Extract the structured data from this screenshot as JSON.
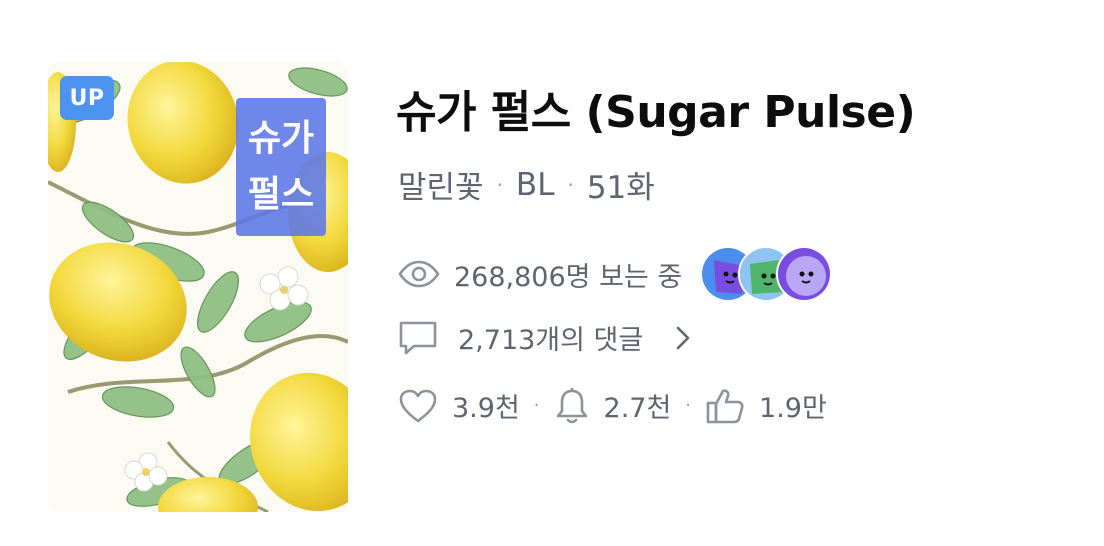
{
  "cover": {
    "badge": "UP",
    "title_line1": "슈가",
    "title_line2": "펄스"
  },
  "title": "슈가 펄스 (Sugar Pulse)",
  "meta": {
    "author": "말린꽃",
    "genre": "BL",
    "episodes": "51화",
    "separator": "·"
  },
  "views": {
    "icon": "eye-icon",
    "text": "268,806명 보는 중"
  },
  "comments": {
    "icon": "comment-icon",
    "text": "2,713개의 댓글"
  },
  "stats": {
    "likes": "3.9천",
    "subscribers": "2.7천",
    "recommends": "1.9만",
    "separator": "·"
  },
  "colors": {
    "badge": "#4d94f0",
    "cover_title_bg": "#5c76e8",
    "text_secondary": "#5f6570",
    "icon_gray": "#8d939b"
  }
}
